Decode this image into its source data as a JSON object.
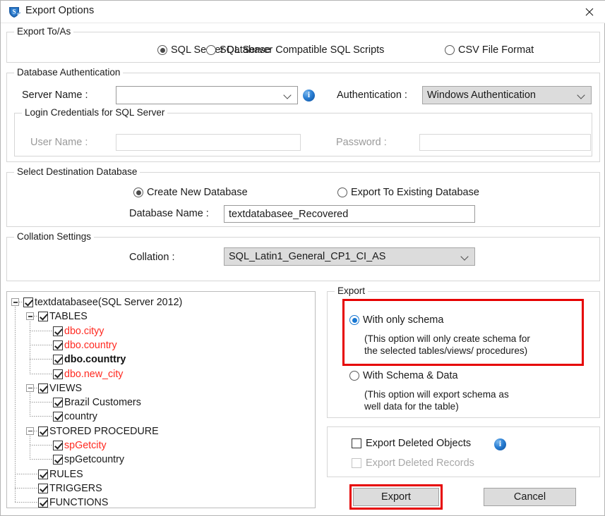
{
  "window": {
    "title": "Export Options",
    "app_icon": "shield-logo-icon",
    "close_icon": "close-icon"
  },
  "export_to_as": {
    "legend": "Export To/As",
    "options": [
      {
        "label": "SQL Server Database",
        "selected": true
      },
      {
        "label": "SQL Server Compatible SQL Scripts",
        "selected": false
      },
      {
        "label": "CSV File Format",
        "selected": false
      }
    ]
  },
  "database_authentication": {
    "legend": "Database Authentication",
    "server_name_label": "Server Name :",
    "server_name_value": "",
    "server_name_info_icon": "info-icon",
    "authentication_label": "Authentication :",
    "authentication_value": "Windows Authentication",
    "login_credentials": {
      "legend": "Login Credentials for SQL Server",
      "user_name_label": "User Name :",
      "user_name_value": "",
      "password_label": "Password :",
      "password_value": ""
    }
  },
  "destination": {
    "legend": "Select Destination Database",
    "options": [
      {
        "label": "Create New Database",
        "selected": true
      },
      {
        "label": "Export To Existing Database",
        "selected": false
      }
    ],
    "database_name_label": "Database Name :",
    "database_name_value": "textdatabasee_Recovered"
  },
  "collation": {
    "legend": "Collation Settings",
    "label": "Collation :",
    "value": "SQL_Latin1_General_CP1_CI_AS"
  },
  "tree": {
    "nodes": [
      {
        "label": "textdatabasee(SQL Server 2012)",
        "depth": 0,
        "checked": true,
        "expander": "collapse",
        "style": "normal"
      },
      {
        "label": "TABLES",
        "depth": 1,
        "checked": true,
        "expander": "collapse",
        "style": "normal"
      },
      {
        "label": "dbo.cityy",
        "depth": 2,
        "checked": true,
        "expander": "none",
        "style": "red"
      },
      {
        "label": "dbo.country",
        "depth": 2,
        "checked": true,
        "expander": "none",
        "style": "red"
      },
      {
        "label": "dbo.counttry",
        "depth": 2,
        "checked": true,
        "expander": "none",
        "style": "bold"
      },
      {
        "label": "dbo.new_city",
        "depth": 2,
        "checked": true,
        "expander": "none",
        "style": "red"
      },
      {
        "label": "VIEWS",
        "depth": 1,
        "checked": true,
        "expander": "collapse",
        "style": "normal"
      },
      {
        "label": "Brazil Customers",
        "depth": 2,
        "checked": true,
        "expander": "none",
        "style": "normal"
      },
      {
        "label": "country",
        "depth": 2,
        "checked": true,
        "expander": "none",
        "style": "normal"
      },
      {
        "label": "STORED PROCEDURE",
        "depth": 1,
        "checked": true,
        "expander": "collapse",
        "style": "normal"
      },
      {
        "label": "spGetcity",
        "depth": 2,
        "checked": true,
        "expander": "none",
        "style": "red"
      },
      {
        "label": "spGetcountry",
        "depth": 2,
        "checked": true,
        "expander": "none",
        "style": "normal"
      },
      {
        "label": "RULES",
        "depth": 1,
        "checked": true,
        "expander": "none",
        "style": "normal"
      },
      {
        "label": "TRIGGERS",
        "depth": 1,
        "checked": true,
        "expander": "none",
        "style": "normal"
      },
      {
        "label": "FUNCTIONS",
        "depth": 1,
        "checked": true,
        "expander": "none",
        "style": "normal"
      }
    ]
  },
  "export_panel": {
    "legend": "Export",
    "option_schema_only": {
      "label": "With only schema",
      "selected": true,
      "description": "(This option will only create schema for\nthe  selected tables/views/ procedures)",
      "highlighted": true
    },
    "option_schema_data": {
      "label": "With Schema & Data",
      "selected": false,
      "description": "(This option will export schema as\nwell data for the table)"
    }
  },
  "deleted_panel": {
    "export_deleted_objects": {
      "label": "Export Deleted Objects",
      "checked": false,
      "enabled": true,
      "info_icon": "info-icon"
    },
    "export_deleted_records": {
      "label": "Export Deleted Records",
      "checked": false,
      "enabled": false
    }
  },
  "buttons": {
    "export": {
      "label": "Export",
      "highlighted": true
    },
    "cancel": {
      "label": "Cancel",
      "highlighted": false
    }
  },
  "colors": {
    "highlight_red": "#e60000",
    "accent_blue": "#1877d2",
    "deleted_item_red": "#ff2a21"
  }
}
